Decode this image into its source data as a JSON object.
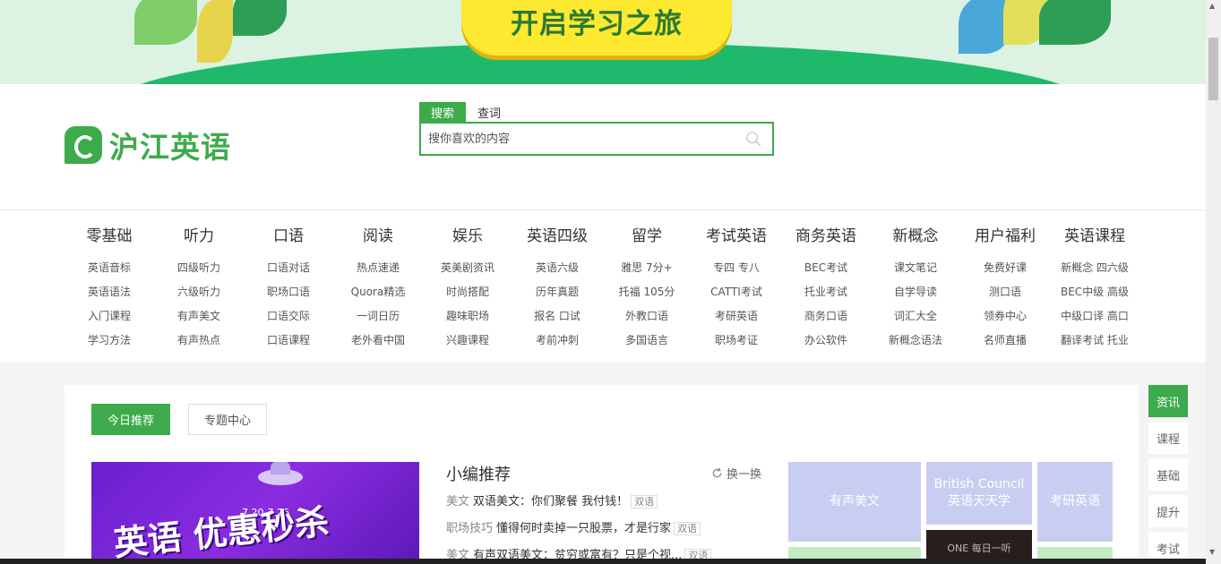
{
  "banner": {
    "cta_label": "开启学习之旅"
  },
  "header": {
    "logo_text": "沪江英语"
  },
  "search": {
    "tabs": [
      "搜索",
      "查词"
    ],
    "placeholder": "搜你喜欢的内容"
  },
  "nav": [
    {
      "title": "零基础",
      "items": [
        "英语音标",
        "英语语法",
        "入门课程",
        "学习方法"
      ]
    },
    {
      "title": "听力",
      "items": [
        "四级听力",
        "六级听力",
        "有声美文",
        "有声热点"
      ]
    },
    {
      "title": "口语",
      "items": [
        "口语对话",
        "职场口语",
        "口语交际",
        "口语课程"
      ]
    },
    {
      "title": "阅读",
      "items": [
        "热点速递",
        "Quora精选",
        "一词日历",
        "老外看中国"
      ]
    },
    {
      "title": "娱乐",
      "items": [
        "英美剧资讯",
        "时尚搭配",
        "趣味职场",
        "兴趣课程"
      ]
    },
    {
      "title": "英语四级",
      "items": [
        "英语六级",
        "历年真题",
        "报名 口试",
        "考前冲刺"
      ]
    },
    {
      "title": "留学",
      "items": [
        "雅思 7分+",
        "托福 105分",
        "外教口语",
        "多国语言"
      ]
    },
    {
      "title": "考试英语",
      "items": [
        "专四 专八",
        "CATTI考试",
        "考研英语",
        "职场考证"
      ]
    },
    {
      "title": "商务英语",
      "items": [
        "BEC考试",
        "托业考试",
        "商务口语",
        "办公软件"
      ]
    },
    {
      "title": "新概念",
      "items": [
        "课文笔记",
        "自学导读",
        "词汇大全",
        "新概念语法"
      ]
    },
    {
      "title": "用户福利",
      "items": [
        "免费好课",
        "测口语",
        "领券中心",
        "名师直播"
      ]
    },
    {
      "title": "英语课程",
      "items": [
        "新概念 四六级",
        "BEC中级 高级",
        "中级口译 高口",
        "翻译考试 托业"
      ]
    }
  ],
  "main": {
    "tabs": [
      "今日推荐",
      "专题中心"
    ],
    "promo": {
      "date": "7.20-7.26",
      "headline": "英语 优惠秒杀"
    },
    "picks": {
      "title": "小编推荐",
      "refresh": "换一换",
      "items": [
        {
          "cat": "美文",
          "text": "双语美文：你们聚餐 我付钱！",
          "tag": "双语"
        },
        {
          "cat": "职场技巧",
          "text": "懂得何时卖掉一只股票，才是行家",
          "tag": "双语"
        },
        {
          "cat": "美文",
          "text": "有声双语美文：贫穷或富有？只是个视...",
          "tag": "双语"
        }
      ]
    },
    "tiles": [
      "有声美文",
      "British Council 英语天天学",
      "考研英语"
    ],
    "tile_photo_text": "ONE 每日一听"
  },
  "side_tabs": [
    "资讯",
    "课程",
    "基础",
    "提升",
    "考试"
  ],
  "colors": {
    "brand_green": "#3dab4b",
    "banner_yellow": "#fde92f",
    "tile_lavender": "#c9cdf1"
  }
}
